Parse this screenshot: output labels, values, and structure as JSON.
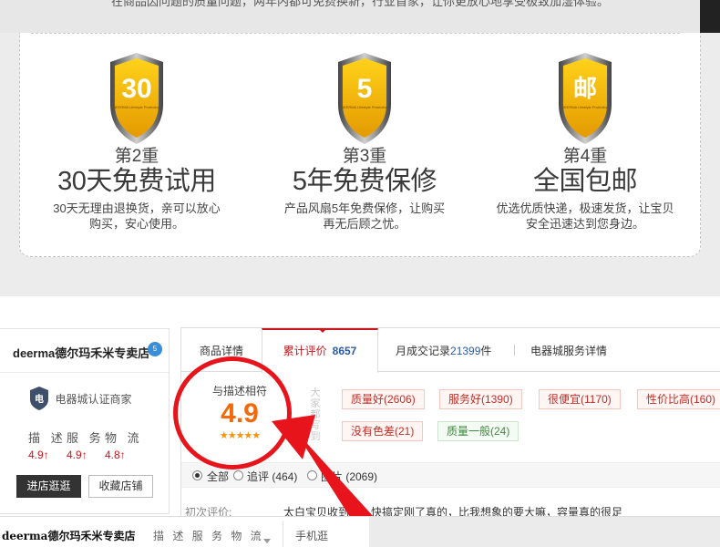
{
  "guarantee": {
    "clipped_text": "在商品因问题的质量问题，两年内都可免费换新，行业首家，让你更放心地享受极致加湿体验。",
    "features": [
      {
        "shield_text": "30",
        "shield_sub": "DEERMA Lifestyle Protection",
        "step": "第2重",
        "title": "30天免费试用",
        "desc_1": "30天无理由退换货，亲可以放心",
        "desc_2": "购买，安心使用。"
      },
      {
        "shield_text": "5",
        "shield_sub": "DEERMA Lifestyle Protection",
        "step": "第3重",
        "title": "5年免费保修",
        "desc_1": "产品风扇5年免费保修，让购买",
        "desc_2": "再无后顾之忧。"
      },
      {
        "shield_text": "邮",
        "shield_sub": "DEERMA Lifestyle Protection",
        "step": "第4重",
        "title": "全国包邮",
        "desc_1": "优选优质快递，极速发货，让宝贝",
        "desc_2": "安全迅速达到您身边。"
      }
    ]
  },
  "store": {
    "name": "deerma德尔玛禾米专卖店",
    "badge": "5",
    "cert_icon": "tmall-shield-icon",
    "cert_label": "电器城认证商家",
    "score_labels": [
      "描 述",
      "服 务",
      "物 流"
    ],
    "score_values": [
      "4.9↑",
      "4.9↑",
      "4.8↑"
    ],
    "enter_label": "进店逛逛",
    "favorite_label": "收藏店铺"
  },
  "tabs": {
    "details": "商品详情",
    "reviews": "累计评价",
    "reviews_count": "8657",
    "monthly_prefix": "月成交记录",
    "monthly_count": "21399",
    "monthly_suffix": "件",
    "service": "电器城服务详情"
  },
  "rating": {
    "label": "与描述相符",
    "value": "4.9",
    "stars": "★★★★★",
    "vertical_label": "大家都写到"
  },
  "tags": {
    "t1": "质量好(2606)",
    "t2": "服务好(1390)",
    "t3": "很便宜(1170)",
    "t4": "性价比高(160)",
    "t5": "没有色差(21)",
    "t6": "质量一般(24)"
  },
  "filters": {
    "all": "全部",
    "followup": "追评 (464)",
    "images": "图片 (2069)"
  },
  "review": {
    "label": "初次评价:",
    "text": "太白宝贝收到了，快搞定刚了真的，比我想象的要大嘛，容量真的很足"
  },
  "bottom_bar": {
    "store": "deerma德尔玛禾米专卖店",
    "score": "描 述 服 务 物 流",
    "mobile": "手机逛"
  },
  "colors": {
    "accent_red": "#c8161d",
    "rating_orange": "#f26a0c",
    "shield_gold": "#f2b705"
  }
}
